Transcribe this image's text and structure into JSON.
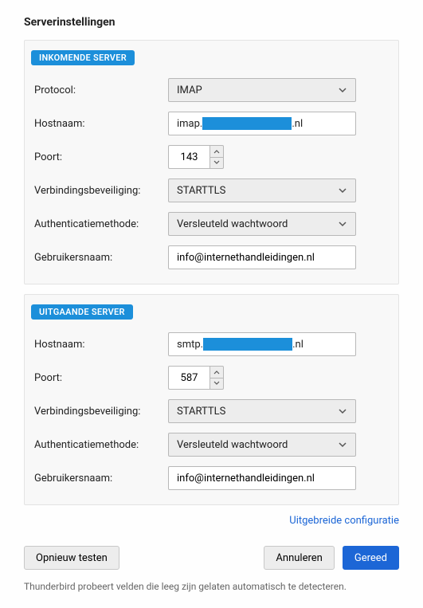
{
  "title": "Serverinstellingen",
  "incoming": {
    "badge": "INKOMENDE SERVER",
    "protocol_label": "Protocol:",
    "protocol_value": "IMAP",
    "hostname_label": "Hostnaam:",
    "hostname_prefix": "imap.",
    "hostname_suffix": ".nl",
    "port_label": "Poort:",
    "port_value": "143",
    "security_label": "Verbindingsbeveiliging:",
    "security_value": "STARTTLS",
    "auth_label": "Authenticatiemethode:",
    "auth_value": "Versleuteld wachtwoord",
    "user_label": "Gebruikersnaam:",
    "user_value": "info@internethandleidingen.nl"
  },
  "outgoing": {
    "badge": "UITGAANDE SERVER",
    "hostname_label": "Hostnaam:",
    "hostname_prefix": "smtp.",
    "hostname_suffix": ".nl",
    "port_label": "Poort:",
    "port_value": "587",
    "security_label": "Verbindingsbeveiliging:",
    "security_value": "STARTTLS",
    "auth_label": "Authenticatiemethode:",
    "auth_value": "Versleuteld wachtwoord",
    "user_label": "Gebruikersnaam:",
    "user_value": "info@internethandleidingen.nl"
  },
  "advanced_link": "Uitgebreide configuratie",
  "buttons": {
    "retest": "Opnieuw testen",
    "cancel": "Annuleren",
    "done": "Gereed"
  },
  "footnote": "Thunderbird probeert velden die leeg zijn gelaten automatisch te detecteren."
}
